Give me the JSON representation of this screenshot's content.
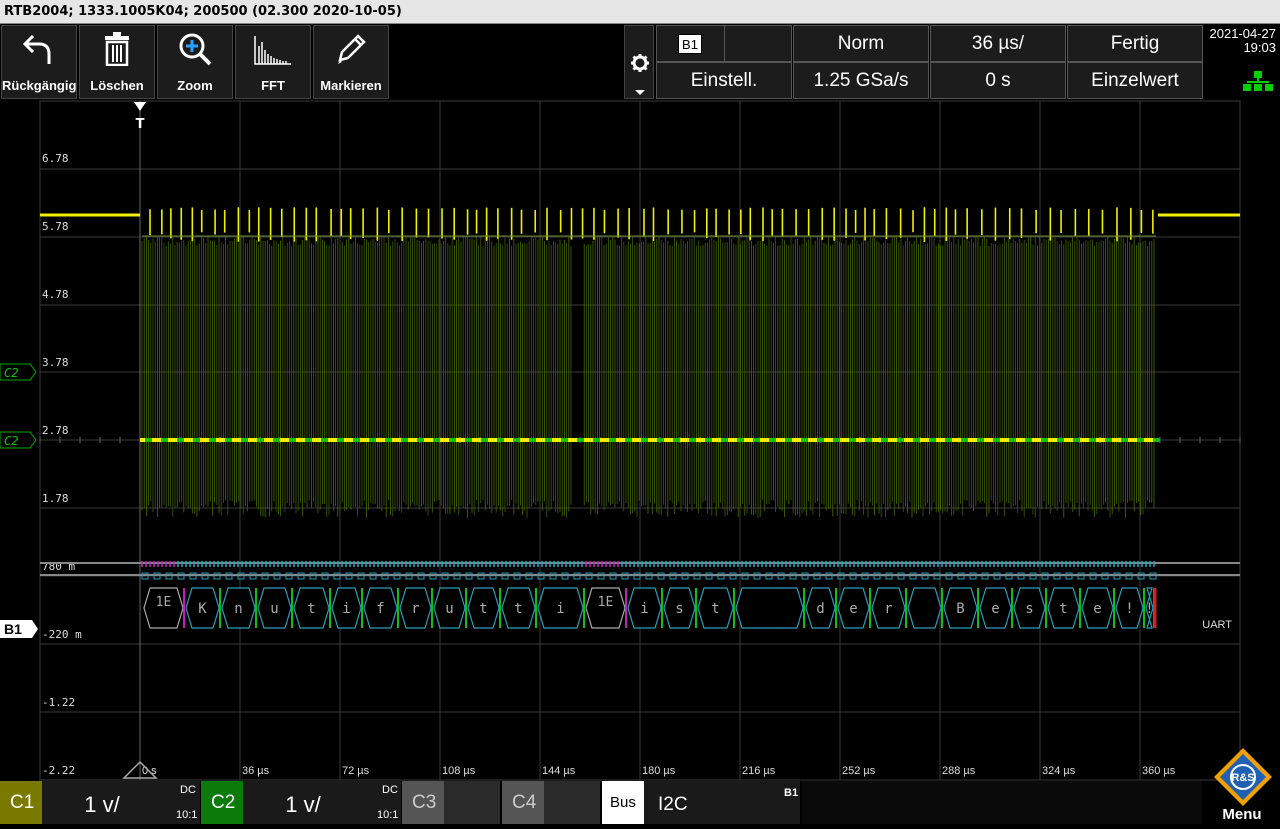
{
  "titlebar": {
    "text": "RTB2004; 1333.1005K04; 200500 (02.300 2020-10-05)"
  },
  "toolbar": {
    "undo": "Rückgängig",
    "delete": "Löschen",
    "zoom": "Zoom",
    "fft": "FFT",
    "mark": "Markieren"
  },
  "status": {
    "bus_id": "B1",
    "trigger_mode": "Norm",
    "timebase": "36 µs/",
    "acq_state": "Fertig",
    "settings": "Einstell.",
    "sample_rate": "1.25 GSa/s",
    "position": "0 s",
    "run_mode": "Einzelwert",
    "date": "2021-04-27",
    "time": "19:03"
  },
  "axis": {
    "y_labels": [
      "6.78",
      "5.78",
      "4.78",
      "3.78",
      "2.78",
      "1.78",
      "780 m",
      "-220 m",
      "-1.22",
      "-2.22"
    ],
    "x_labels": [
      "0 s",
      "36 µs",
      "72 µs",
      "108 µs",
      "144 µs",
      "180 µs",
      "216 µs",
      "252 µs",
      "288 µs",
      "324 µs",
      "360 µs"
    ],
    "trigger_marker": "T",
    "ch_markers": [
      "C2",
      "C2"
    ],
    "bus_marker": "B1",
    "bus_protocol": "UART"
  },
  "decode": {
    "frames": [
      "1E",
      "K",
      "n",
      "u",
      "t",
      "i",
      "f",
      "r",
      "u",
      "t",
      "t",
      "i",
      "1E",
      "i",
      "s",
      "t",
      " ",
      "d",
      "e",
      "r",
      " ",
      "B",
      "e",
      "s",
      "t",
      "e",
      "!",
      "!"
    ]
  },
  "channels": {
    "c1": {
      "label": "C1",
      "scale": "1 v/",
      "coupling": "DC",
      "ratio": "10:1",
      "color": "#c8c800"
    },
    "c2": {
      "label": "C2",
      "scale": "1 v/",
      "coupling": "DC",
      "ratio": "10:1",
      "color": "#00c800"
    },
    "c3": {
      "label": "C3"
    },
    "c4": {
      "label": "C4"
    },
    "bus": {
      "label": "Bus",
      "protocol": "I2C",
      "id": "B1"
    }
  },
  "menu": "Menu",
  "logo": "R&S"
}
